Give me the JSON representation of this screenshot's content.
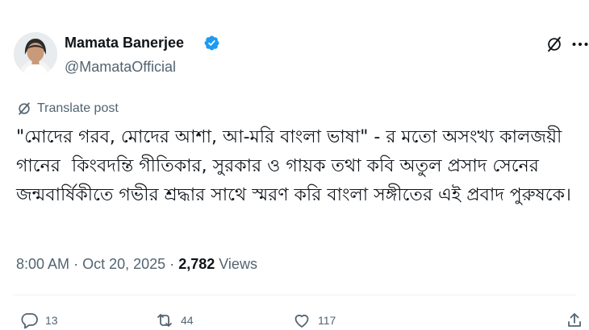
{
  "author": {
    "name": "Mamata Banerjee",
    "handle": "@MamataOfficial",
    "verified": true,
    "avatar_icon": "profile-photo"
  },
  "header_icons": [
    "grok-icon",
    "more-options-icon"
  ],
  "translate_label": "Translate post",
  "post": {
    "text": "\"মোদের গরব, মোদের আশা, আ-মরি বাংলা ভাষা\" - র মতো অসংখ্য কালজয়ী গানের  কিংবদন্তি গীতিকার, সুরকার ও গায়ক তথা কবি অতুল প্রসাদ সেনের জন্মবার্ষিকীতে গভীর শ্রদ্ধার সাথে স্মরণ করি বাংলা সঙ্গীতের এই প্রবাদ পুরুষকে।"
  },
  "meta": {
    "time": "8:00 AM",
    "date": "Oct 20, 2025",
    "separator": "·",
    "views_count": "2,782",
    "views_label": "Views"
  },
  "actions": {
    "replies": "13",
    "reposts": "44",
    "likes": "117"
  },
  "colors": {
    "text_primary": "#0f1419",
    "text_secondary": "#536471",
    "verified_blue": "#1d9bf0",
    "divider": "#eff3f4"
  }
}
